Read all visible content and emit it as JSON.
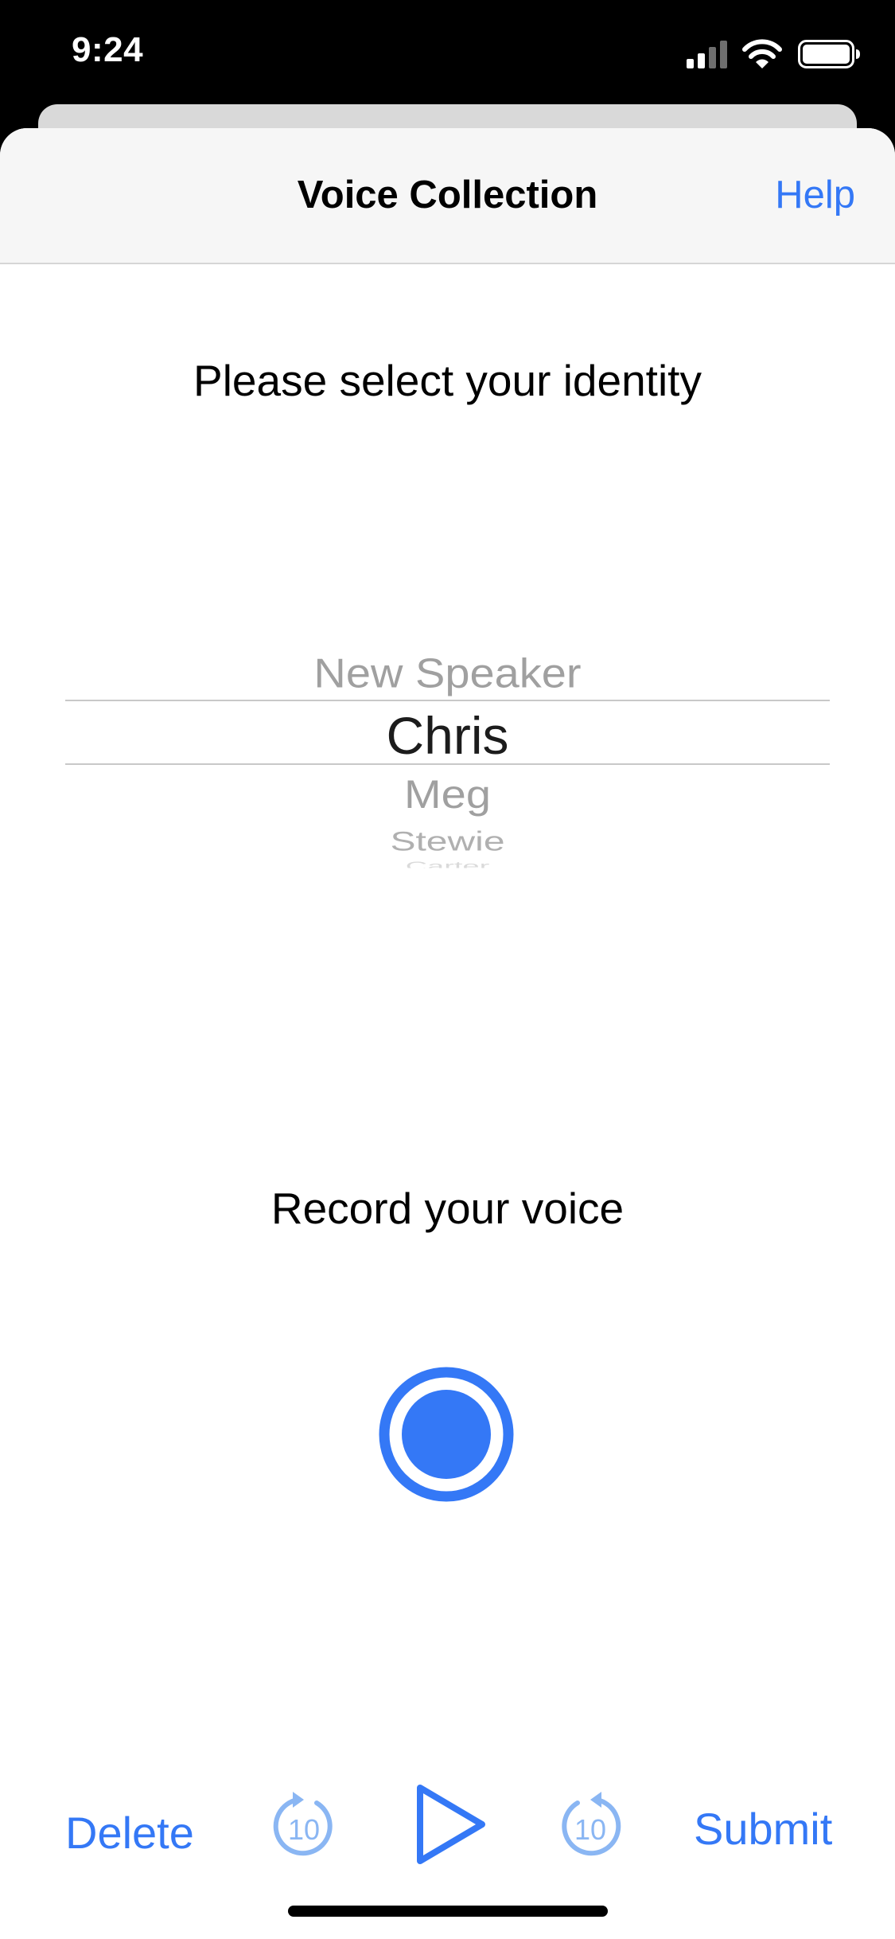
{
  "status_bar": {
    "time": "9:24",
    "icons": [
      "signal-icon",
      "wifi-icon",
      "battery-icon"
    ]
  },
  "nav": {
    "title": "Voice Collection",
    "help_label": "Help"
  },
  "identity": {
    "prompt": "Please select your identity",
    "options": [
      "New Speaker",
      "Chris",
      "Meg",
      "Stewie",
      "Carter"
    ],
    "selected": "Chris"
  },
  "record": {
    "prompt": "Record your voice"
  },
  "controls": {
    "delete_label": "Delete",
    "rewind_seconds": "10",
    "forward_seconds": "10",
    "submit_label": "Submit"
  },
  "colors": {
    "accent": "#3478f6",
    "accent_light": "#8ab6f3",
    "nav_background": "#f6f6f6"
  }
}
